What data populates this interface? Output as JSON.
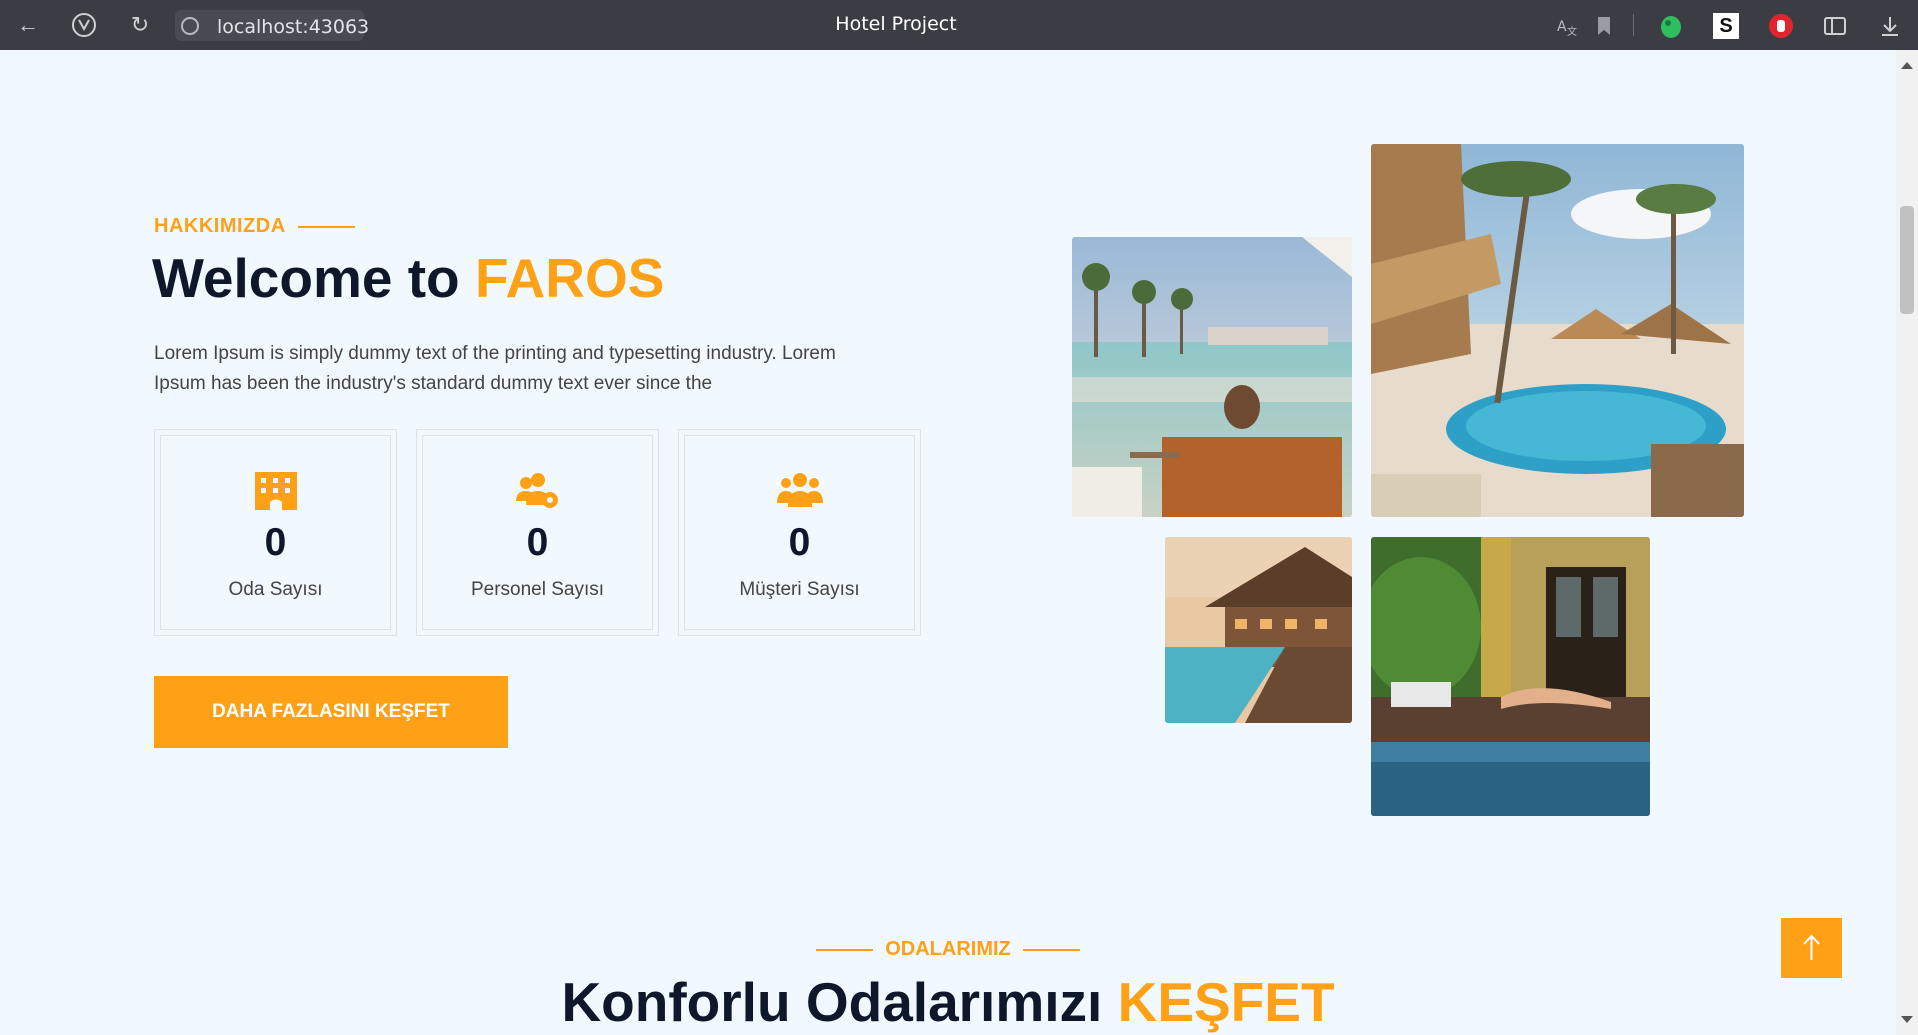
{
  "browser": {
    "url": "localhost:43063",
    "tab_title": "Hotel Project",
    "toolbar_icons": [
      "back-icon",
      "brand-v-icon",
      "reload-icon",
      "site-info-icon",
      "translate-icon",
      "bookmark-icon",
      "evernote-icon",
      "s-extension-icon",
      "stop-hand-icon",
      "sidebar-icon",
      "download-icon"
    ],
    "s_extension_letter": "S"
  },
  "about": {
    "kicker": "HAKKIMIZDA",
    "title_prefix": "Welcome to",
    "title_accent": "FAROS",
    "description": "Lorem Ipsum is simply dummy text of the printing and typesetting industry. Lorem Ipsum has been the industry's standard dummy text ever since the",
    "stats": [
      {
        "icon": "hotel-icon",
        "value": "0",
        "label": "Oda Sayısı"
      },
      {
        "icon": "users-cog-icon",
        "value": "0",
        "label": "Personel Sayısı"
      },
      {
        "icon": "users-icon",
        "value": "0",
        "label": "Müşteri Sayısı"
      }
    ],
    "cta_label": "DAHA FAZLASINI KEŞFET"
  },
  "gallery": [
    "pool-deck-photo",
    "tropical-resort-photo",
    "poolside-restaurant-photo",
    "sunbather-photo"
  ],
  "rooms": {
    "kicker": "ODALARIMIZ",
    "title_prefix": "Konforlu Odalarımızı",
    "title_accent": "KEŞFET"
  },
  "back_to_top": "arrow-up-icon",
  "colors": {
    "accent": "#FEA116",
    "dark": "#0F172B",
    "background": "#F1F8FE",
    "browser_bar": "#3C3C45"
  }
}
